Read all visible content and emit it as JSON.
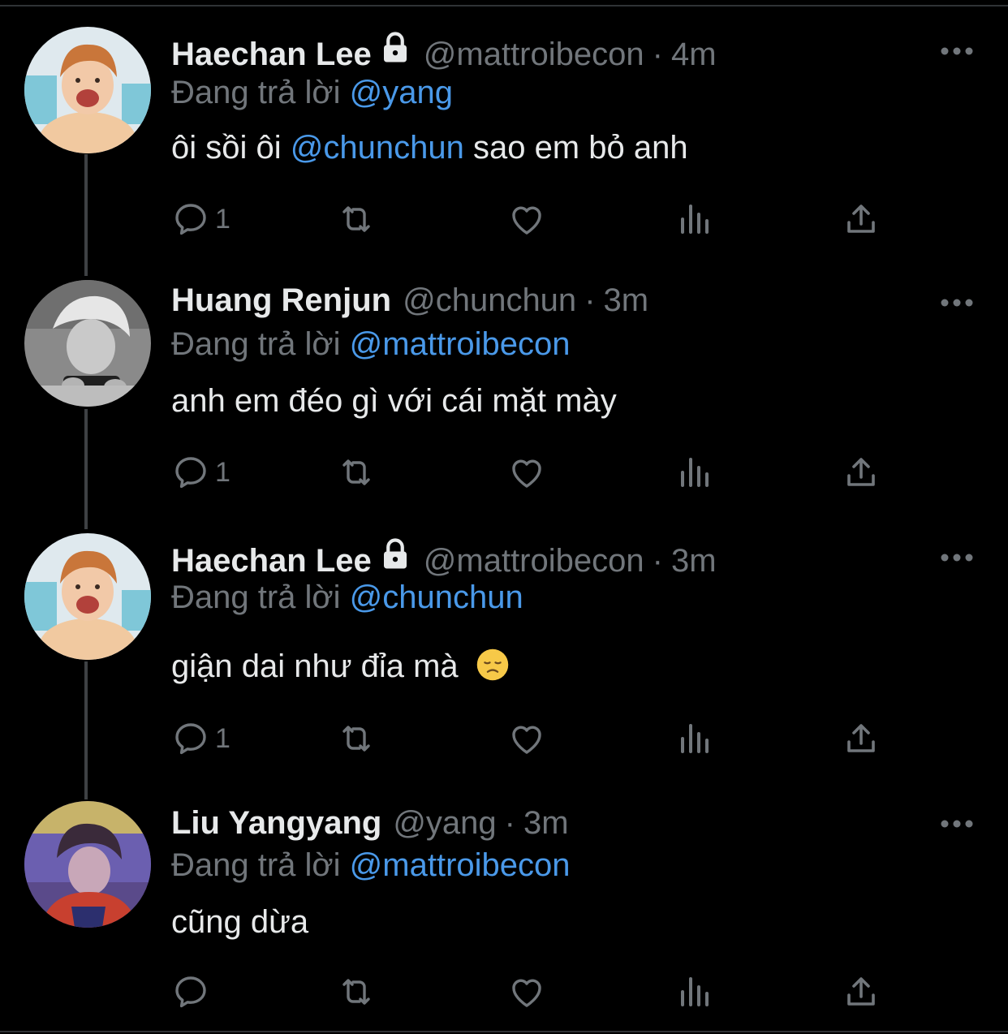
{
  "reply_to_prefix": "Đang trả lời",
  "tweets": [
    {
      "name": "Haechan Lee",
      "locked": true,
      "handle": "@mattroibecon",
      "separator": "·",
      "time": "4m",
      "reply_to": "@yang",
      "text_parts": [
        "ôi sồi ôi ",
        "@chunchun",
        " sao em bỏ anh"
      ],
      "reply_count": "1",
      "avatar": "haechan-avatar"
    },
    {
      "name": "Huang Renjun",
      "locked": false,
      "handle": "@chunchun",
      "separator": "·",
      "time": "3m",
      "reply_to": "@mattroibecon",
      "text": "anh em đéo gì với cái mặt mày",
      "reply_count": "1",
      "avatar": "renjun-avatar"
    },
    {
      "name": "Haechan Lee",
      "locked": true,
      "handle": "@mattroibecon",
      "separator": "·",
      "time": "3m",
      "reply_to": "@chunchun",
      "text": "giận dai như đỉa mà",
      "emoji": "disappointed-face-emoji",
      "reply_count": "1",
      "avatar": "haechan-avatar"
    },
    {
      "name": "Liu Yangyang",
      "locked": false,
      "handle": "@yang",
      "separator": "·",
      "time": "3m",
      "reply_to": "@mattroibecon",
      "text": "cũng dừa",
      "reply_count": "",
      "avatar": "yangyang-avatar"
    }
  ],
  "colors": {
    "background": "#000000",
    "text": "#e7e9ea",
    "muted": "#71767b",
    "mention": "#4a99e9",
    "thread_line": "#3e4144"
  }
}
